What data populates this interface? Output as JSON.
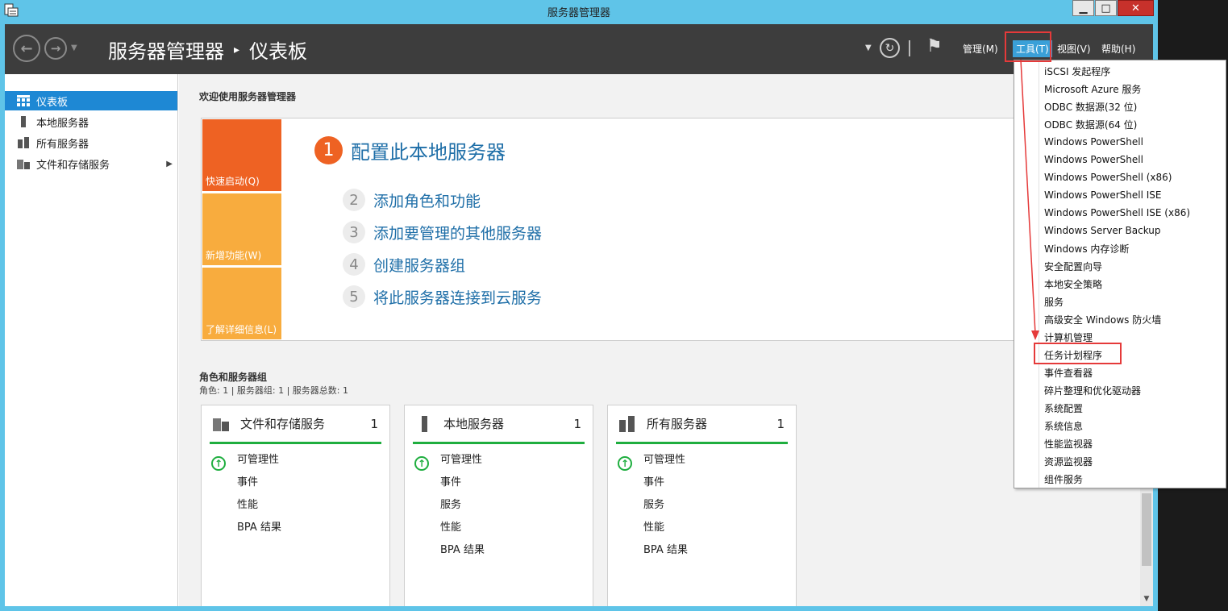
{
  "window": {
    "title": "服务器管理器"
  },
  "header": {
    "breadcrumb": [
      "服务器管理器",
      "仪表板"
    ],
    "menus": {
      "manage": "管理(M)",
      "tools": "工具(T)",
      "view": "视图(V)",
      "help": "帮助(H)"
    }
  },
  "sidebar": {
    "items": [
      {
        "label": "仪表板",
        "icon": "dashboard-icon",
        "active": true
      },
      {
        "label": "本地服务器",
        "icon": "server-icon",
        "active": false
      },
      {
        "label": "所有服务器",
        "icon": "servers-icon",
        "active": false
      },
      {
        "label": "文件和存储服务",
        "icon": "storage-icon",
        "active": false
      }
    ]
  },
  "welcome": {
    "title": "欢迎使用服务器管理器",
    "tiles": [
      "快速启动(Q)",
      "新增功能(W)",
      "了解详细信息(L)"
    ],
    "steps": [
      {
        "num": "1",
        "label": "配置此本地服务器"
      },
      {
        "num": "2",
        "label": "添加角色和功能"
      },
      {
        "num": "3",
        "label": "添加要管理的其他服务器"
      },
      {
        "num": "4",
        "label": "创建服务器组"
      },
      {
        "num": "5",
        "label": "将此服务器连接到云服务"
      }
    ]
  },
  "roles": {
    "title": "角色和服务器组",
    "subtitle": "角色: 1 | 服务器组: 1 | 服务器总数: 1",
    "cards": [
      {
        "title": "文件和存储服务",
        "count": "1",
        "rows": [
          "可管理性",
          "事件",
          "性能",
          "BPA 结果"
        ]
      },
      {
        "title": "本地服务器",
        "count": "1",
        "rows": [
          "可管理性",
          "事件",
          "服务",
          "性能",
          "BPA 结果"
        ]
      },
      {
        "title": "所有服务器",
        "count": "1",
        "rows": [
          "可管理性",
          "事件",
          "服务",
          "性能",
          "BPA 结果"
        ]
      }
    ]
  },
  "tools_menu": {
    "items": [
      "iSCSI 发起程序",
      "Microsoft Azure 服务",
      "ODBC 数据源(32 位)",
      "ODBC 数据源(64 位)",
      "Windows PowerShell",
      "Windows PowerShell",
      "Windows PowerShell (x86)",
      "Windows PowerShell ISE",
      "Windows PowerShell ISE (x86)",
      "Windows Server Backup",
      "Windows 内存诊断",
      "安全配置向导",
      "本地安全策略",
      "服务",
      "高级安全 Windows 防火墙",
      "计算机管理",
      "任务计划程序",
      "事件查看器",
      "碎片整理和优化驱动器",
      "系统配置",
      "系统信息",
      "性能监视器",
      "资源监视器",
      "组件服务"
    ],
    "highlighted": "任务计划程序"
  },
  "colors": {
    "accent": "#1e88d4",
    "orange": "#ee6223",
    "amber": "#f8ac3e",
    "green": "#1fae3f",
    "highlight": "#e53a3a"
  }
}
